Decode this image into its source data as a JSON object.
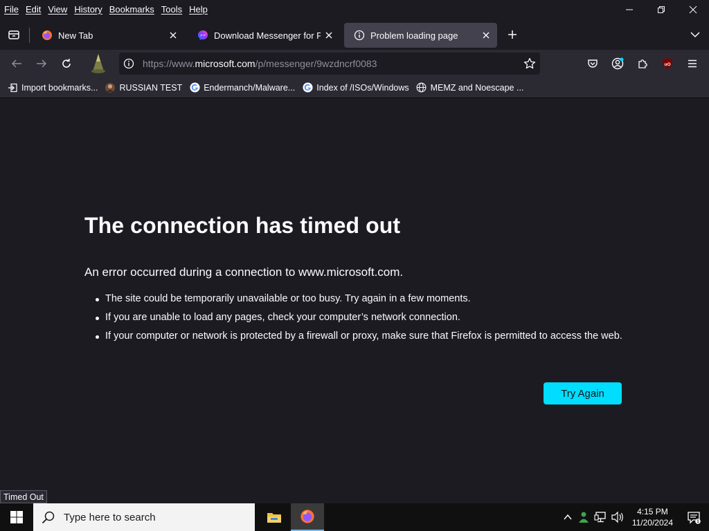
{
  "menu": [
    "File",
    "Edit",
    "View",
    "History",
    "Bookmarks",
    "Tools",
    "Help"
  ],
  "tabs": [
    {
      "label": "New Tab",
      "icon": "firefox-icon"
    },
    {
      "label": "Download Messenger for PC/Mac",
      "icon": "messenger-icon"
    },
    {
      "label": "Problem loading page",
      "icon": "info-icon"
    }
  ],
  "urlbar": {
    "prefix": "https://www.",
    "domain": "microsoft.com",
    "path": "/p/messenger/9wzdncrf0083"
  },
  "bookmarks": [
    {
      "label": "Import bookmarks...",
      "icon": "import-icon"
    },
    {
      "label": "RUSSIAN TEST",
      "icon": "avatar-icon"
    },
    {
      "label": "Endermanch/Malware...",
      "icon": "google-icon"
    },
    {
      "label": "Index of /ISOs/Windows",
      "icon": "google-icon"
    },
    {
      "label": "MEMZ and Noescape ...",
      "icon": "globe-icon"
    }
  ],
  "error": {
    "title": "The connection has timed out",
    "description": "An error occurred during a connection to www.microsoft.com.",
    "bullets": [
      "The site could be temporarily unavailable or too busy. Try again in a few moments.",
      "If you are unable to load any pages, check your computer’s network connection.",
      "If your computer or network is protected by a firewall or proxy, make sure that Firefox is permitted to access the web."
    ],
    "button": "Try Again"
  },
  "status_tooltip": "Timed Out",
  "taskbar": {
    "search_placeholder": "Type here to search",
    "time": "4:15 PM",
    "date": "11/20/2024"
  },
  "colors": {
    "accent": "#00ddff",
    "background": "#1c1b22",
    "toolbar": "#2b2a33"
  }
}
